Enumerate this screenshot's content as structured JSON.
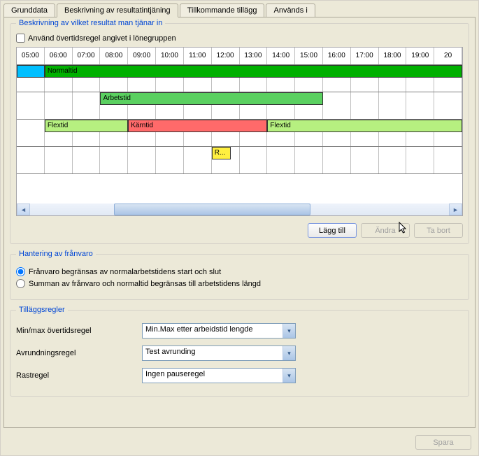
{
  "tabs": [
    {
      "label": "Grunddata"
    },
    {
      "label": "Beskrivning av resultatintjäning"
    },
    {
      "label": "Tillkommande tillägg"
    },
    {
      "label": "Används i"
    }
  ],
  "section1": {
    "title": "Beskrivning av vilket resultat man tjänar in",
    "use_overtime_label": "Använd övertidsregel angivet i lönegruppen",
    "time_header": [
      "05:00",
      "06:00",
      "07:00",
      "08:00",
      "09:00",
      "10:00",
      "11:00",
      "12:00",
      "13:00",
      "14:00",
      "15:00",
      "16:00",
      "17:00",
      "18:00",
      "19:00",
      "20"
    ],
    "bars": {
      "cyan": {
        "label": "",
        "start": 0.0,
        "end": 6.25,
        "color": "#00bfff"
      },
      "normal": {
        "label": "Normaltid",
        "start": 6.25,
        "end": 100.0,
        "color": "#00b000"
      },
      "arbetstid": {
        "label": "Arbetstid",
        "start": 18.75,
        "end": 68.75,
        "color": "#5ad060"
      },
      "flex1": {
        "label": "Flextid",
        "start": 6.25,
        "end": 25.0,
        "color": "#b6f080"
      },
      "karntid": {
        "label": "Kärntid",
        "start": 25.0,
        "end": 56.25,
        "color": "#ff6a6a"
      },
      "flex2": {
        "label": "Flextid",
        "start": 56.25,
        "end": 100.0,
        "color": "#b6f080"
      },
      "rast": {
        "label": "R...",
        "start": 43.75,
        "end": 48.0,
        "color": "#fff040"
      }
    },
    "buttons": {
      "add": "Lägg till",
      "edit": "Ändra",
      "delete": "Ta bort"
    }
  },
  "section2": {
    "title": "Hantering av frånvaro",
    "option1": "Frånvaro begränsas av normalarbetstidens start och slut",
    "option2": "Summan av frånvaro och normaltid begränsas till arbetstidens längd"
  },
  "section3": {
    "title": "Tilläggsregler",
    "labels": {
      "minmax": "Min/max övertidsregel",
      "rounding": "Avrundningsregel",
      "break": "Rastregel"
    },
    "values": {
      "minmax": "Min.Max etter arbeidstid lengde",
      "rounding": "Test avrunding",
      "break": "Ingen pauseregel"
    }
  },
  "footer": {
    "save": "Spara"
  }
}
